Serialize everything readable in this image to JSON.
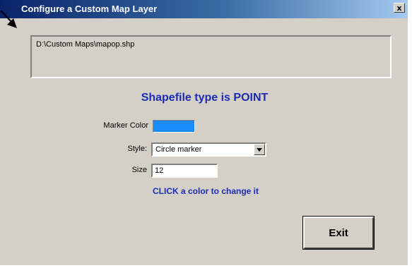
{
  "window": {
    "title": "Configure a Custom Map Layer",
    "close_label": "x"
  },
  "file": {
    "path": "D:\\Custom Maps\\mapop.shp"
  },
  "shapefile_type_text": "Shapefile type is POINT",
  "marker_color": {
    "label": "Marker Color",
    "value": "#1a8cff"
  },
  "style": {
    "label": "Style:",
    "selected": "Circle marker"
  },
  "size": {
    "label": "Size",
    "value": "12"
  },
  "hint": "CLICK a color to change it",
  "exit_button": "Exit",
  "icons": {
    "cursor": "mouse-pointer-arrow",
    "close": "close-icon",
    "dropdown": "chevron-down-icon"
  }
}
